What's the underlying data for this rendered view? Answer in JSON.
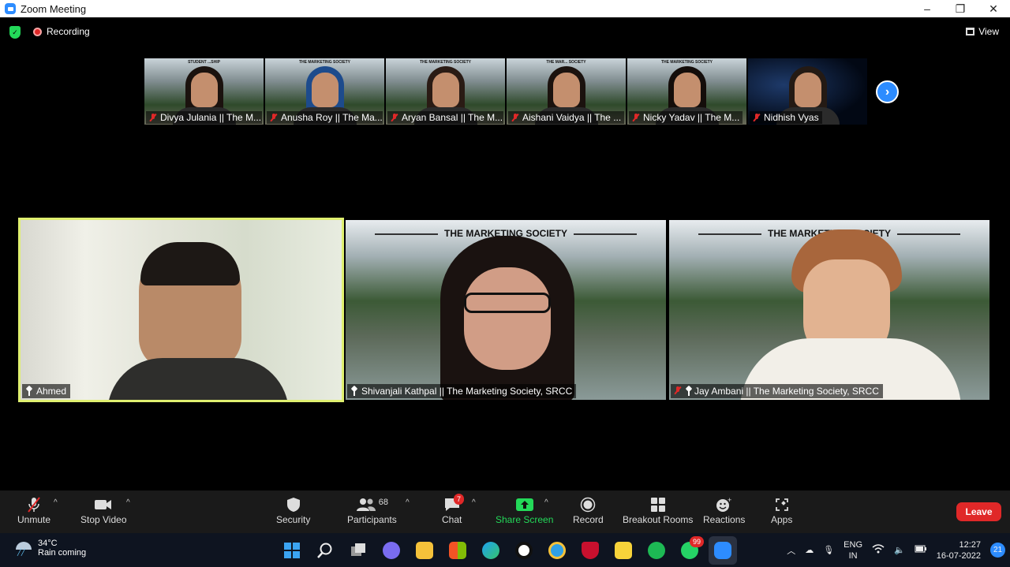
{
  "window": {
    "title": "Zoom Meeting",
    "controls": [
      "–",
      "❐",
      "✕"
    ]
  },
  "topbar": {
    "recording_label": "Recording",
    "view_label": "View"
  },
  "thumbnails": [
    {
      "name": "Divya Julania || The M...",
      "banner": "STUDENT ...SHIP",
      "muted": true,
      "dark": false,
      "hair": "#1b120e"
    },
    {
      "name": "Anusha Roy || The Ma...",
      "banner": "THE MARKETING SOCIETY",
      "muted": true,
      "dark": false,
      "hair": "#1d4b8c"
    },
    {
      "name": "Aryan Bansal || The M...",
      "banner": "THE MARKETING SOCIETY",
      "muted": true,
      "dark": false,
      "hair": "#2a1b14"
    },
    {
      "name": "Aishani Vaidya || The ...",
      "banner": "THE MAR... SOCIETY",
      "muted": true,
      "dark": false,
      "hair": "#1b120e"
    },
    {
      "name": "Nicky Yadav || The M...",
      "banner": "THE MARKETING SOCIETY",
      "muted": true,
      "dark": false,
      "hair": "#140d0a"
    },
    {
      "name": "Nidhish Vyas",
      "banner": "",
      "muted": true,
      "dark": true,
      "hair": "#241a14"
    }
  ],
  "next_button": "›",
  "tiles": [
    {
      "name": "Ahmed",
      "header": "",
      "muted": false,
      "pinned": true
    },
    {
      "name": "Shivanjali Kathpal || The Marketing Society, SRCC",
      "header": "THE MARKETING SOCIETY",
      "muted": false,
      "pinned": true
    },
    {
      "name": "Jay Ambani || The Marketing Society, SRCC",
      "header": "THE MARKETING SOCIETY",
      "muted": true,
      "pinned": true
    }
  ],
  "toolbar": {
    "unmute": "Unmute",
    "stop_video": "Stop Video",
    "security": "Security",
    "participants": "Participants",
    "participants_count": "68",
    "chat": "Chat",
    "chat_badge": "7",
    "share_screen": "Share Screen",
    "record": "Record",
    "breakout_rooms": "Breakout Rooms",
    "reactions": "Reactions",
    "apps": "Apps",
    "leave": "Leave"
  },
  "taskbar": {
    "temperature": "34°C",
    "weather": "Rain coming",
    "whatsapp_badge": "99",
    "language_top": "ENG",
    "language_bottom": "IN",
    "time": "12:27",
    "date": "16-07-2022",
    "notifications": "21"
  },
  "colors": {
    "zoom_blue": "#2d8cff",
    "active_speaker": "#e0f070",
    "leave_red": "#e02828",
    "share_green": "#23d959"
  }
}
